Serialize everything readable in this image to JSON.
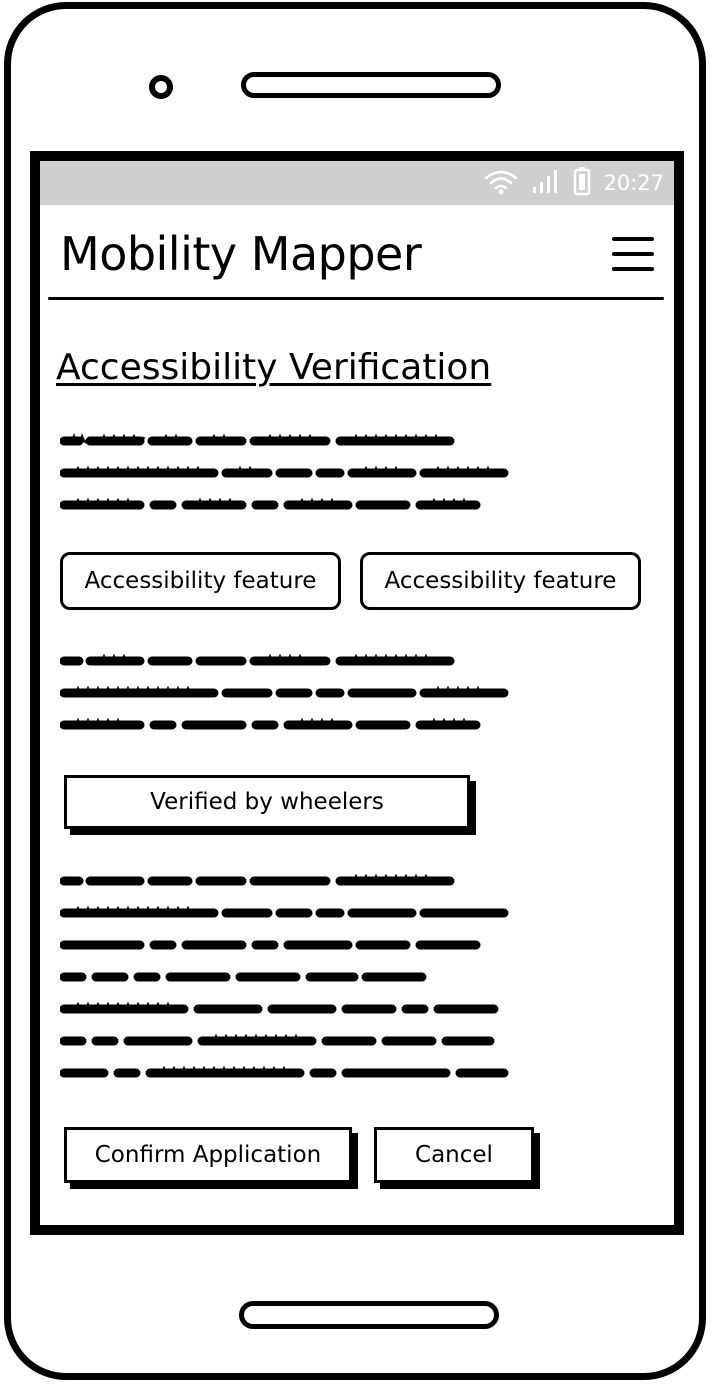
{
  "status_bar": {
    "time": "20:27"
  },
  "app_bar": {
    "title": "Mobility Mapper"
  },
  "page": {
    "title": "Accessibility Verification"
  },
  "features": [
    {
      "label": "Accessibility feature"
    },
    {
      "label": "Accessibility feature"
    }
  ],
  "verified_label": "Verified by wheelers",
  "actions": {
    "confirm_label": "Confirm Application",
    "cancel_label": "Cancel"
  },
  "icons": [
    "camera-icon",
    "wifi-icon",
    "signal-icon",
    "battery-icon",
    "hamburger-menu-icon"
  ]
}
